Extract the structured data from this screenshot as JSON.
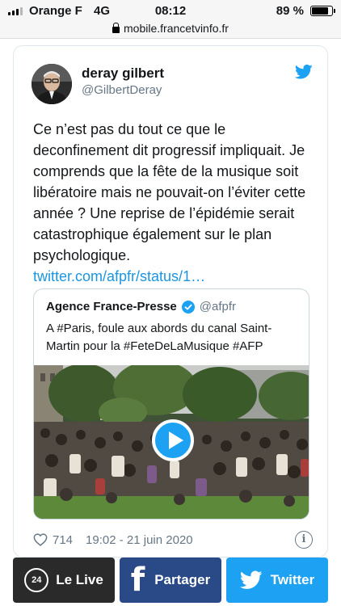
{
  "status_bar": {
    "carrier": "Orange F",
    "network": "4G",
    "time": "08:12",
    "battery_percent": "89 %",
    "battery_level": 0.89
  },
  "url_bar": {
    "url": "mobile.francetvinfo.fr"
  },
  "tweet": {
    "author_name": "deray gilbert",
    "author_handle": "@GilbertDeray",
    "text": "Ce n’est pas du tout ce que le deconfinement dit progressif impliquait. Je comprends que la fête de la musique soit libératoire mais ne pouvait-on l’éviter cette année ? Une reprise de l’épidémie serait catastrophique également sur le plan psychologique.",
    "link": "twitter.com/afpfr/status/1…",
    "likes": "714",
    "timestamp": "19:02 - 21 juin 2020",
    "quoted": {
      "name": "Agence France-Presse",
      "handle": "@afpfr",
      "text": "A #Paris, foule aux abords du canal Saint-Martin pour la #FeteDeLaMusique #AFP"
    }
  },
  "bottom_bar": {
    "live_label": "Le Live",
    "live_icon_text": "24",
    "share_label": "Partager",
    "twitter_label": "Twitter"
  },
  "colors": {
    "twitter_blue": "#1da1f2",
    "link_blue": "#1b95e0",
    "facebook_blue": "#2a4a87",
    "live_dark": "#2a2a2a",
    "muted_text": "#657786"
  },
  "icons": [
    "signal-icon",
    "lock-icon",
    "twitter-bird-icon",
    "verified-icon",
    "play-icon",
    "heart-icon",
    "info-icon",
    "live-24-icon",
    "facebook-icon",
    "twitter-icon"
  ]
}
